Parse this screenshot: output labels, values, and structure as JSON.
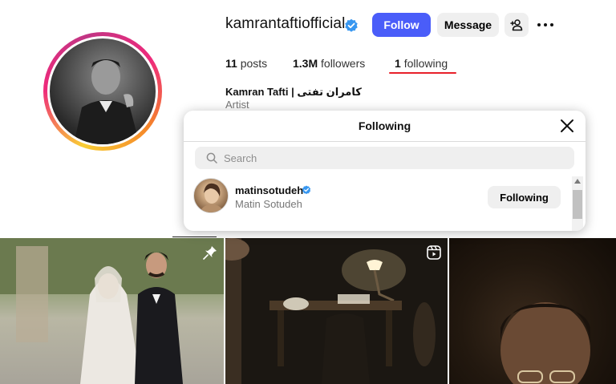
{
  "profile": {
    "username": "kamrantaftiofficial",
    "follow_label": "Follow",
    "message_label": "Message",
    "posts_count": "11",
    "posts_label": "posts",
    "followers_count": "1.3M",
    "followers_label": "followers",
    "following_count": "1",
    "following_label": "following",
    "full_name": "Kamran Tafti | کامران تفتی",
    "category": "Artist"
  },
  "modal": {
    "title": "Following",
    "search_placeholder": "Search",
    "users": [
      {
        "handle": "matinsotudeh",
        "name": "Matin Sotudeh",
        "button_label": "Following",
        "verified": true
      }
    ]
  },
  "icons": {
    "verified": "verified-badge-icon",
    "add_user": "add-user-icon",
    "more": "more-options-icon",
    "close": "close-icon",
    "search": "search-icon",
    "pin": "pin-icon",
    "reel": "reel-icon"
  },
  "colors": {
    "accent": "#4a5df9",
    "verified": "#3897f0",
    "highlight_underline": "#e8202a"
  }
}
